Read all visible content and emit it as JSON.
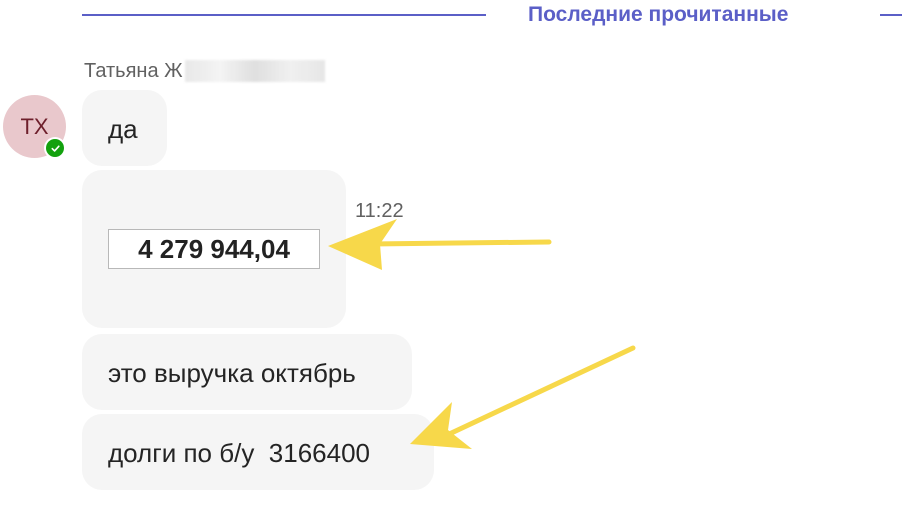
{
  "divider": {
    "label": "Последние прочитанные"
  },
  "sender": {
    "name": "Татьяна Ж",
    "initials": "ТХ",
    "status": "available"
  },
  "messages": [
    {
      "text": "да"
    },
    {
      "value": "4 279 944,04",
      "time": "11:22"
    },
    {
      "text": "это выручка октябрь"
    },
    {
      "text": "долги по б/у  3166400"
    }
  ],
  "colors": {
    "accent": "#5b5fc7",
    "bubble": "#f5f5f5",
    "avatar_bg": "#e9c8cc",
    "avatar_text": "#6e1f2b",
    "presence": "#13a10e",
    "annotation_arrow": "#f7d84a"
  }
}
